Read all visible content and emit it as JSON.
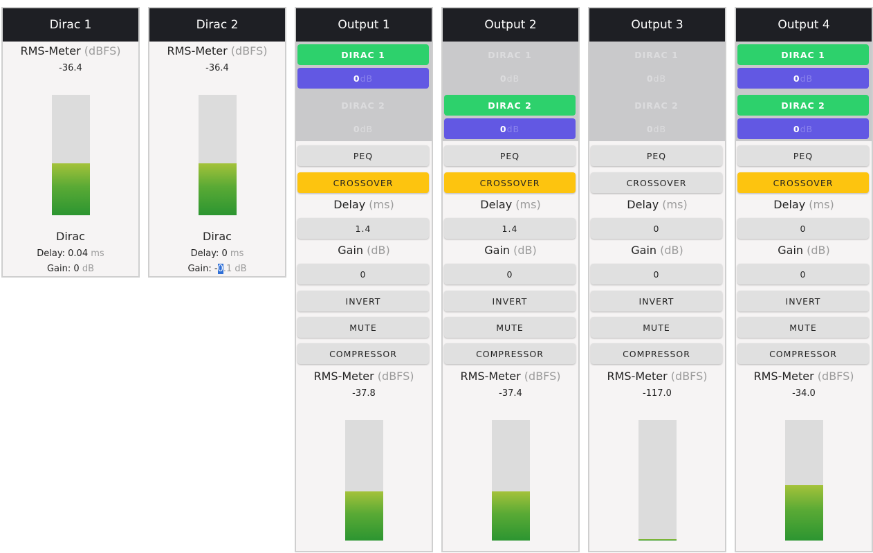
{
  "dirac": [
    {
      "title": "Dirac 1",
      "rms_label": "RMS-Meter",
      "rms_unit": "(dBFS)",
      "rms_value": "-36.4",
      "level": 0.43,
      "name": "Dirac",
      "delay_label": "Delay:",
      "delay_value": "0.04",
      "delay_unit": "ms",
      "gain_label": "Gain:",
      "gain_value": "0",
      "gain_unit": "dB"
    },
    {
      "title": "Dirac 2",
      "rms_label": "RMS-Meter",
      "rms_unit": "(dBFS)",
      "rms_value": "-36.4",
      "level": 0.43,
      "name": "Dirac",
      "delay_label": "Delay:",
      "delay_value": "0",
      "delay_unit": "ms",
      "gain_label": "Gain:",
      "gain_pre": "-",
      "gain_sel": "0",
      "gain_post": ".1",
      "gain_unit": "dB"
    }
  ],
  "outputs": [
    {
      "title": "Output 1",
      "src1": "DIRAC 1",
      "src1_gain": "0",
      "src2": "DIRAC 2",
      "src2_gain": "0",
      "db": "dB",
      "peq": "PEQ",
      "crossover": "CROSSOVER",
      "delay_label": "Delay",
      "delay_unit": "(ms)",
      "delay_value": "1.4",
      "gain_label": "Gain",
      "gain_unit": "(dB)",
      "gain_value": "0",
      "invert": "INVERT",
      "mute": "MUTE",
      "compressor": "COMPRESSOR",
      "rms_label": "RMS-Meter",
      "rms_unit": "(dBFS)",
      "rms_value": "-37.8",
      "level": 0.41
    },
    {
      "title": "Output 2",
      "src1": "DIRAC 1",
      "src1_gain": "0",
      "src2": "DIRAC 2",
      "src2_gain": "0",
      "db": "dB",
      "peq": "PEQ",
      "crossover": "CROSSOVER",
      "delay_label": "Delay",
      "delay_unit": "(ms)",
      "delay_value": "1.4",
      "gain_label": "Gain",
      "gain_unit": "(dB)",
      "gain_value": "0",
      "invert": "INVERT",
      "mute": "MUTE",
      "compressor": "COMPRESSOR",
      "rms_label": "RMS-Meter",
      "rms_unit": "(dBFS)",
      "rms_value": "-37.4",
      "level": 0.41
    },
    {
      "title": "Output 3",
      "src1": "DIRAC 1",
      "src1_gain": "0",
      "src2": "DIRAC 2",
      "src2_gain": "0",
      "db": "dB",
      "peq": "PEQ",
      "crossover": "CROSSOVER",
      "delay_label": "Delay",
      "delay_unit": "(ms)",
      "delay_value": "0",
      "gain_label": "Gain",
      "gain_unit": "(dB)",
      "gain_value": "0",
      "invert": "INVERT",
      "mute": "MUTE",
      "compressor": "COMPRESSOR",
      "rms_label": "RMS-Meter",
      "rms_unit": "(dBFS)",
      "rms_value": "-117.0",
      "level": 0.01
    },
    {
      "title": "Output 4",
      "src1": "DIRAC 1",
      "src1_gain": "0",
      "src2": "DIRAC 2",
      "src2_gain": "0",
      "db": "dB",
      "peq": "PEQ",
      "crossover": "CROSSOVER",
      "delay_label": "Delay",
      "delay_unit": "(ms)",
      "delay_value": "0",
      "gain_label": "Gain",
      "gain_unit": "(dB)",
      "gain_value": "0",
      "invert": "INVERT",
      "mute": "MUTE",
      "compressor": "COMPRESSOR",
      "rms_label": "RMS-Meter",
      "rms_unit": "(dBFS)",
      "rms_value": "-34.0",
      "level": 0.46
    }
  ],
  "state": {
    "routing": [
      [
        true,
        false
      ],
      [
        false,
        true
      ],
      [
        false,
        false
      ],
      [
        true,
        true
      ]
    ],
    "crossover_active": [
      true,
      true,
      false,
      true
    ]
  },
  "colors": {
    "header": "#1e1f24",
    "source_on": "#2dd16c",
    "gain_on": "#6258e3",
    "crossover_on": "#fdc40f",
    "panel": "#f6f4f4"
  }
}
